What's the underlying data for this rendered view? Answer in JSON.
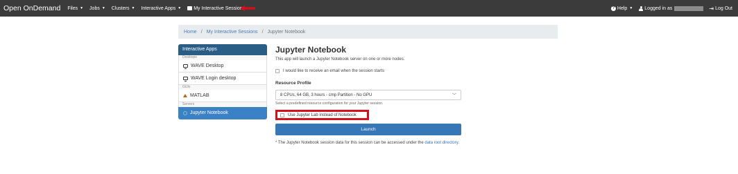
{
  "navbar": {
    "brand": "Open OnDemand",
    "items": [
      {
        "label": "Files"
      },
      {
        "label": "Jobs"
      },
      {
        "label": "Clusters"
      },
      {
        "label": "Interactive Apps"
      }
    ],
    "sessions_label": "My Interactive Sessions",
    "help_label": "Help",
    "logged_in_label": "Logged in as",
    "logout_label": "Log Out",
    "annotation_color": "#d3101b"
  },
  "breadcrumb": {
    "home": "Home",
    "sep": "/",
    "sessions": "My Interactive Sessions",
    "current": "Jupyter Notebook"
  },
  "sidebar": {
    "header": "Interactive Apps",
    "groups": [
      {
        "category": "Desktops",
        "items": [
          {
            "label": "WAVE Desktop",
            "icon": "monitor-icon"
          },
          {
            "label": "WAVE Login desktop",
            "icon": "monitor-icon"
          }
        ]
      },
      {
        "category": "GUIs",
        "items": [
          {
            "label": "MATLAB",
            "icon": "matlab-icon"
          }
        ]
      },
      {
        "category": "Servers",
        "items": [
          {
            "label": "Jupyter Notebook",
            "icon": "jupyter-icon"
          }
        ]
      }
    ]
  },
  "main": {
    "title": "Jupyter Notebook",
    "description": "This app will launch a Jupyter Notebook server on one or more nodes.",
    "email_checkbox_label": "I would like to receive an email when the session starts",
    "resource_label": "Resource Profile",
    "resource_value": "8 CPUs, 64 GB, 3 hours - cmp Partition - No GPU",
    "resource_help": "Select a predefined resource configuration for your Jupyter session.",
    "jupyterlab_checkbox_label": "Use Jupyter Lab instead of Notebook",
    "launch_label": "Launch",
    "note_prefix": "* The Jupyter Notebook session data for this session can be accessed under the",
    "note_link": "data root directory",
    "note_suffix": "."
  }
}
